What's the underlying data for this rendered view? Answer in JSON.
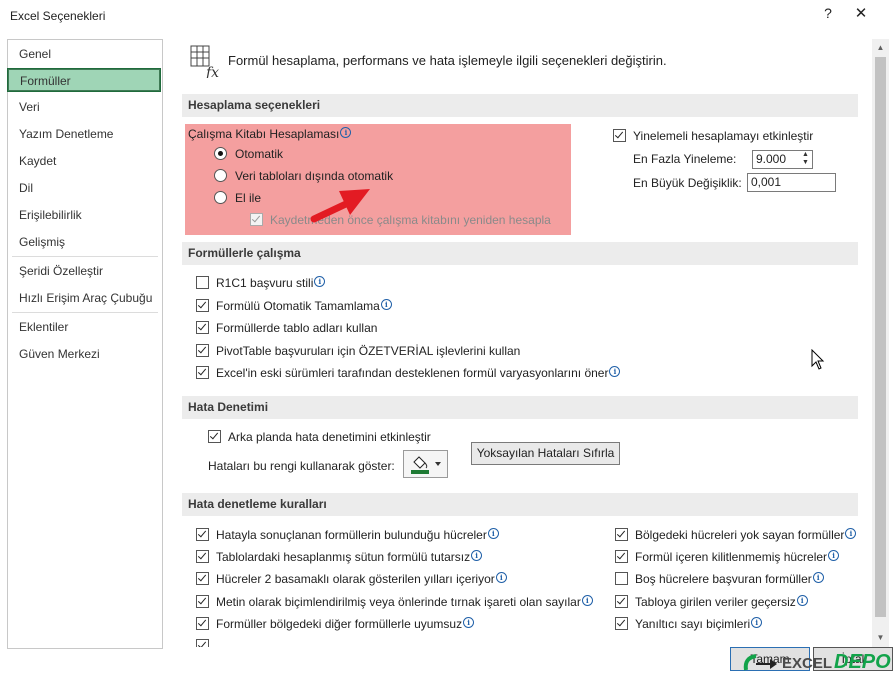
{
  "window": {
    "title": "Excel Seçenekleri",
    "help": "?",
    "close": "✕"
  },
  "sidebar": {
    "items": [
      {
        "label": "Genel"
      },
      {
        "label": "Formüller"
      },
      {
        "label": "Veri"
      },
      {
        "label": "Yazım Denetleme"
      },
      {
        "label": "Kaydet"
      },
      {
        "label": "Dil"
      },
      {
        "label": "Erişilebilirlik"
      },
      {
        "label": "Gelişmiş"
      },
      {
        "label": "Şeridi Özelleştir"
      },
      {
        "label": "Hızlı Erişim Araç Çubuğu"
      },
      {
        "label": "Eklentiler"
      },
      {
        "label": "Güven Merkezi"
      }
    ],
    "selected": "Formüller"
  },
  "header": {
    "text": "Formül hesaplama, performans ve hata işlemeyle ilgili seçenekleri değiştirin.",
    "icon": "formula-fx-icon"
  },
  "calc": {
    "section": "Hesaplama seçenekleri",
    "group_label": "Çalışma Kitabı Hesaplaması",
    "options": [
      {
        "label": "Otomatik",
        "selected": true
      },
      {
        "label": "Veri tabloları dışında otomatik",
        "selected": false
      },
      {
        "label": "El ile",
        "selected": false
      }
    ],
    "recalc_before_save": "Kaydetmeden önce çalışma kitabını yeniden hesapla",
    "iterative": "Yinelemeli hesaplamayı etkinleştir",
    "max_iter_label": "En Fazla Yineleme:",
    "max_iter_value": "9.000",
    "max_change_label": "En Büyük Değişiklik:",
    "max_change_value": "0,001",
    "highlight_color": "#f39a9a",
    "arrow_color": "#e31b23"
  },
  "formulas": {
    "section": "Formüllerle çalışma",
    "items": [
      {
        "label": "R1C1 başvuru stili",
        "checked": false
      },
      {
        "label": "Formülü Otomatik Tamamlama",
        "checked": true
      },
      {
        "label": "Formüllerde tablo adları kullan",
        "checked": true
      },
      {
        "label": "PivotTable başvuruları için ÖZETVERİAL işlevlerini kullan",
        "checked": true
      },
      {
        "label": "Excel'in eski sürümleri tarafından desteklenen formül varyasyonlarını öner",
        "checked": true
      }
    ]
  },
  "errors": {
    "section": "Hata Denetimi",
    "background_check": "Arka planda hata denetimini etkinleştir",
    "color_label": "Hataları bu rengi kullanarak göster:",
    "reset_button": "Yoksayılan Hataları Sıfırla",
    "color_value": "#1e7a34"
  },
  "rules": {
    "section": "Hata denetleme kuralları",
    "left": [
      {
        "label": "Hatayla sonuçlanan formüllerin bulunduğu hücreler",
        "checked": true
      },
      {
        "label": "Tablolardaki hesaplanmış sütun formülü tutarsız",
        "checked": true
      },
      {
        "label": "Hücreler 2 basamaklı olarak gösterilen yılları içeriyor",
        "checked": true
      },
      {
        "label": "Metin olarak biçimlendirilmiş veya önlerinde tırnak işareti olan sayılar",
        "checked": true
      },
      {
        "label": "Formüller bölgedeki diğer formüllerle uyumsuz",
        "checked": true
      }
    ],
    "right": [
      {
        "label": "Bölgedeki hücreleri yok sayan formüller",
        "checked": true
      },
      {
        "label": "Formül içeren kilitlenmemiş hücreler",
        "checked": true
      },
      {
        "label": "Boş hücrelere başvuran formüller",
        "checked": false
      },
      {
        "label": "Tabloya girilen veriler geçersiz",
        "checked": true
      },
      {
        "label": "Yanıltıcı sayı biçimleri",
        "checked": true
      }
    ]
  },
  "footer": {
    "ok": "Tamam",
    "cancel": "İptal"
  },
  "watermark": {
    "part1": "EXCEL",
    "part2": "DEPO"
  }
}
